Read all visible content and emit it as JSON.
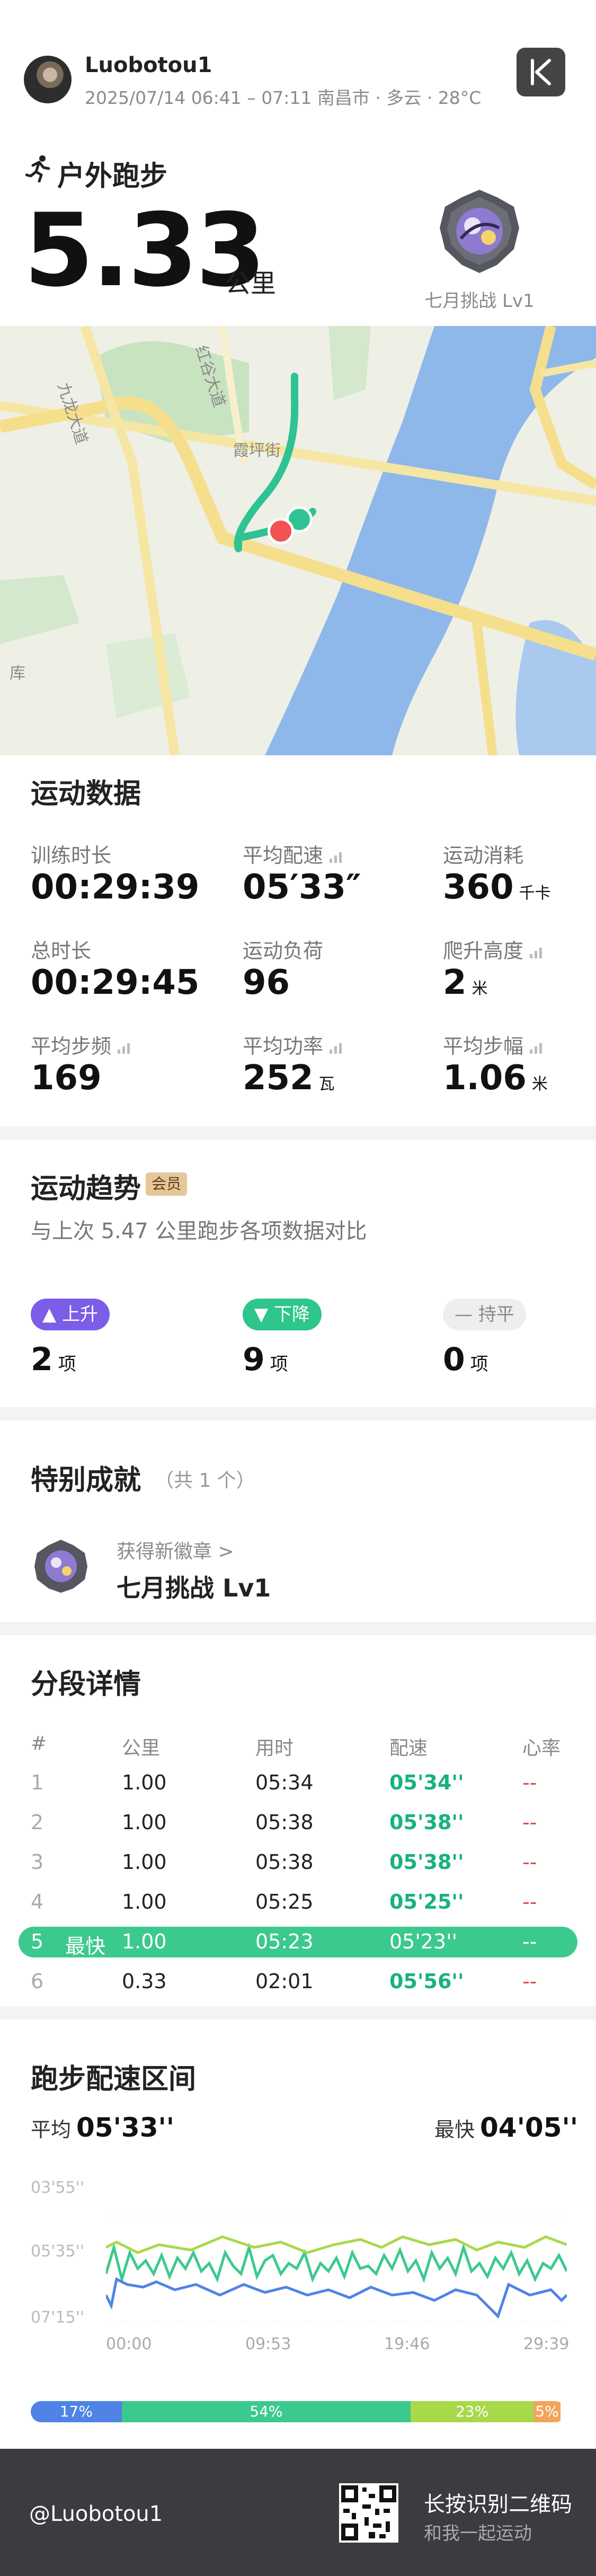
{
  "header": {
    "username": "Luobotou1",
    "meta": "2025/07/14 06:41 – 07:11 南昌市 · 多云 · 28°C",
    "activity": "户外跑步",
    "distance": "5.33",
    "distance_unit": "公里",
    "medal_label": "七月挑战 Lv1"
  },
  "map": {
    "roads": [
      "九龙大道",
      "红谷大道",
      "霞坪街"
    ],
    "other_label": "库"
  },
  "stats": {
    "title": "运动数据",
    "items": [
      {
        "label": "训练时长",
        "value": "00:29:39",
        "unit": ""
      },
      {
        "label": "平均配速",
        "value": "05′33″",
        "unit": ""
      },
      {
        "label": "运动消耗",
        "value": "360",
        "unit": "千卡"
      },
      {
        "label": "总时长",
        "value": "00:29:45",
        "unit": ""
      },
      {
        "label": "运动负荷",
        "value": "96",
        "unit": ""
      },
      {
        "label": "爬升高度",
        "value": "2",
        "unit": "米"
      },
      {
        "label": "平均步频",
        "value": "169",
        "unit": ""
      },
      {
        "label": "平均功率",
        "value": "252",
        "unit": "瓦"
      },
      {
        "label": "平均步幅",
        "value": "1.06",
        "unit": "米"
      }
    ]
  },
  "trend": {
    "title": "运动趋势",
    "badge": "会员",
    "subtitle": "与上次 5.47 公里跑步各项数据对比",
    "items": [
      {
        "label": "上升",
        "count": "2",
        "unit": "项",
        "color": "#7b5de8"
      },
      {
        "label": "下降",
        "count": "9",
        "unit": "项",
        "color": "#2ec68a"
      },
      {
        "label": "持平",
        "count": "0",
        "unit": "项",
        "color": "#eeeeee"
      }
    ]
  },
  "achievement": {
    "title": "特别成就",
    "count_label": "（共 1 个）",
    "new_badge_label": "获得新徽章 >",
    "badge_name": "七月挑战 Lv1"
  },
  "splits": {
    "title": "分段详情",
    "headers": [
      "#",
      "公里",
      "用时",
      "配速",
      "心率"
    ],
    "rows": [
      {
        "idx": "1",
        "tag": "",
        "km": "1.00",
        "time": "05:34",
        "pace": "05'34''",
        "hr": "--"
      },
      {
        "idx": "2",
        "tag": "",
        "km": "1.00",
        "time": "05:38",
        "pace": "05'38''",
        "hr": "--"
      },
      {
        "idx": "3",
        "tag": "",
        "km": "1.00",
        "time": "05:38",
        "pace": "05'38''",
        "hr": "--"
      },
      {
        "idx": "4",
        "tag": "",
        "km": "1.00",
        "time": "05:25",
        "pace": "05'25''",
        "hr": "--"
      },
      {
        "idx": "5",
        "tag": "最快",
        "km": "1.00",
        "time": "05:23",
        "pace": "05'23''",
        "hr": "--"
      },
      {
        "idx": "6",
        "tag": "",
        "km": "0.33",
        "time": "02:01",
        "pace": "05'56''",
        "hr": "--"
      }
    ]
  },
  "pace_zones": {
    "title": "跑步配速区间",
    "avg_label": "平均",
    "avg_value": "05'33''",
    "fastest_label": "最快",
    "fastest_value": "04'05''",
    "y_ticks": [
      "03'55''",
      "05'35''",
      "07'15''"
    ],
    "x_ticks": [
      "00:00",
      "09:53",
      "19:46",
      "29:39"
    ],
    "zones": [
      {
        "pct": "17%",
        "value": 17,
        "color": "#4f83e6"
      },
      {
        "pct": "54%",
        "value": 54,
        "color": "#3cc98d"
      },
      {
        "pct": "23%",
        "value": 23,
        "color": "#a8d94a"
      },
      {
        "pct": "5%",
        "value": 5,
        "color": "#f3a45b"
      }
    ]
  },
  "footer": {
    "user": "@Luobotou1",
    "title": "长按识别二维码",
    "subtitle": "和我一起运动"
  }
}
